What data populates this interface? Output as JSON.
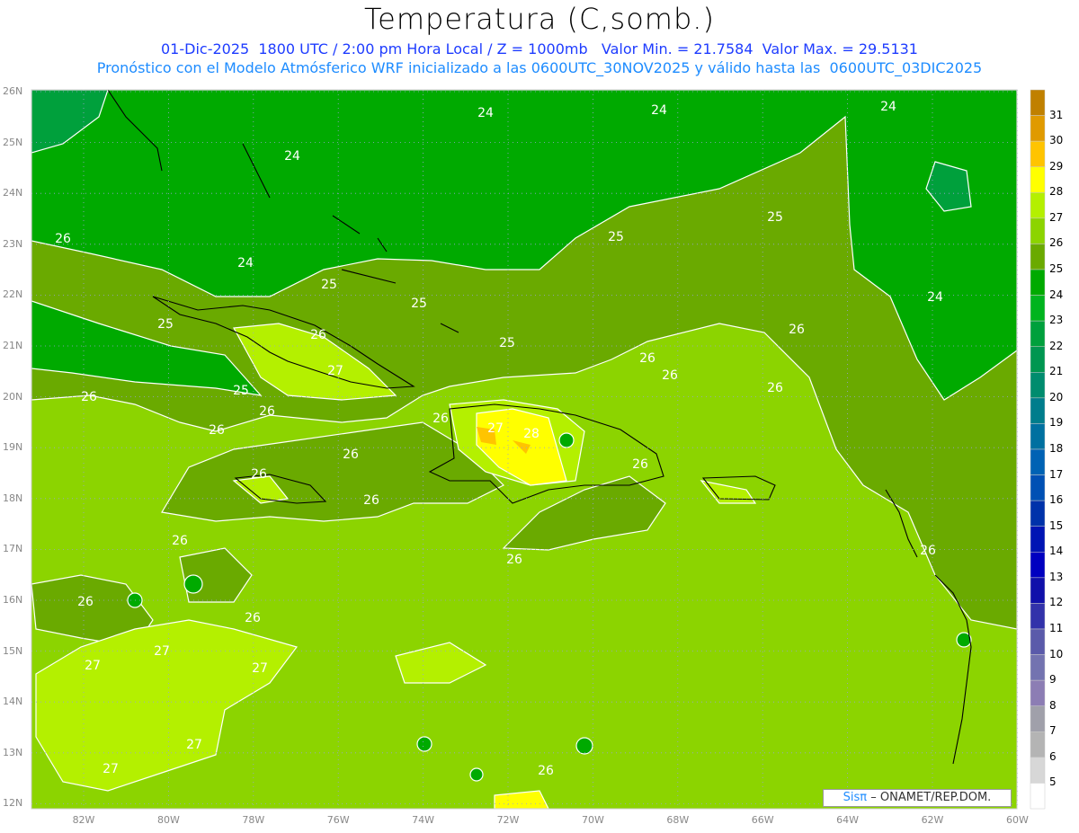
{
  "header": {
    "title": "Temperatura (C,somb.)",
    "subtitle_1": "01-Dic-2025  1800 UTC / 2:00 pm Hora Local / Z = 1000mb   Valor Min. = 21.7584  Valor Max. = 29.5131",
    "subtitle_2": "Pronóstico con el Modelo Atmósferico WRF inicializado a las 0600UTC_30NOV2025 y válido hasta las  0600UTC_03DIC2025"
  },
  "axes": {
    "lat_labels": [
      "26N",
      "25N",
      "24N",
      "23N",
      "22N",
      "21N",
      "20N",
      "19N",
      "18N",
      "17N",
      "16N",
      "15N",
      "14N",
      "13N",
      "12N"
    ],
    "lon_labels": [
      "82W",
      "80W",
      "78W",
      "76W",
      "74W",
      "72W",
      "70W",
      "68W",
      "66W",
      "64W",
      "62W",
      "60W"
    ]
  },
  "colorbar": {
    "labels": [
      "31",
      "30",
      "29",
      "28",
      "27",
      "26",
      "25",
      "24",
      "23",
      "22",
      "21",
      "20",
      "19",
      "18",
      "17",
      "16",
      "15",
      "14",
      "13",
      "12",
      "11",
      "10",
      "9",
      "8",
      "7",
      "6",
      "5"
    ],
    "colors": [
      "#c08000",
      "#e09a00",
      "#ffc400",
      "#ffff00",
      "#b4f000",
      "#8cd400",
      "#6aaa00",
      "#00aa00",
      "#00b41e",
      "#00a03c",
      "#009650",
      "#008c6e",
      "#007d8c",
      "#0070a0",
      "#0062b4",
      "#0050b4",
      "#0032aa",
      "#0014b4",
      "#0000c0",
      "#1010aa",
      "#3232aa",
      "#5a5aaa",
      "#7373b0",
      "#8c7db4",
      "#a0a0aa",
      "#b4b4b4",
      "#d7d7d7",
      "#ffffff"
    ]
  },
  "contour_labels": [
    "24",
    "24",
    "24",
    "24",
    "24",
    "24",
    "25",
    "25",
    "25",
    "25",
    "25",
    "25",
    "25",
    "26",
    "26",
    "26",
    "26",
    "26",
    "26",
    "26",
    "26",
    "26",
    "26",
    "26",
    "26",
    "26",
    "26",
    "26",
    "26",
    "26",
    "26",
    "26",
    "26",
    "27",
    "27",
    "27",
    "27",
    "27",
    "27",
    "27",
    "28"
  ],
  "credit": {
    "logo": "Sisπ",
    "text": "– ONAMET/REP.DOM."
  }
}
